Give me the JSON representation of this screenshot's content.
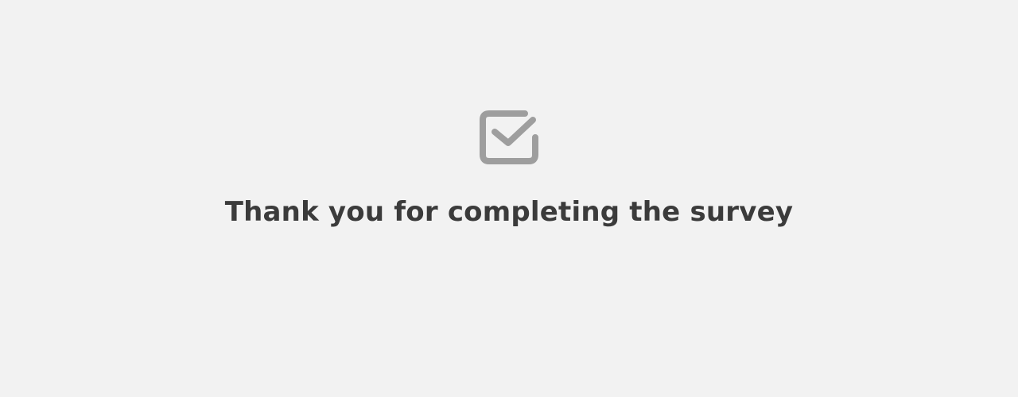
{
  "completion": {
    "icon": "checkbox-checked-icon",
    "message": "Thank you for completing the survey"
  },
  "colors": {
    "background": "#f2f2f2",
    "icon": "#9e9e9e",
    "text": "#3b3b3b"
  }
}
